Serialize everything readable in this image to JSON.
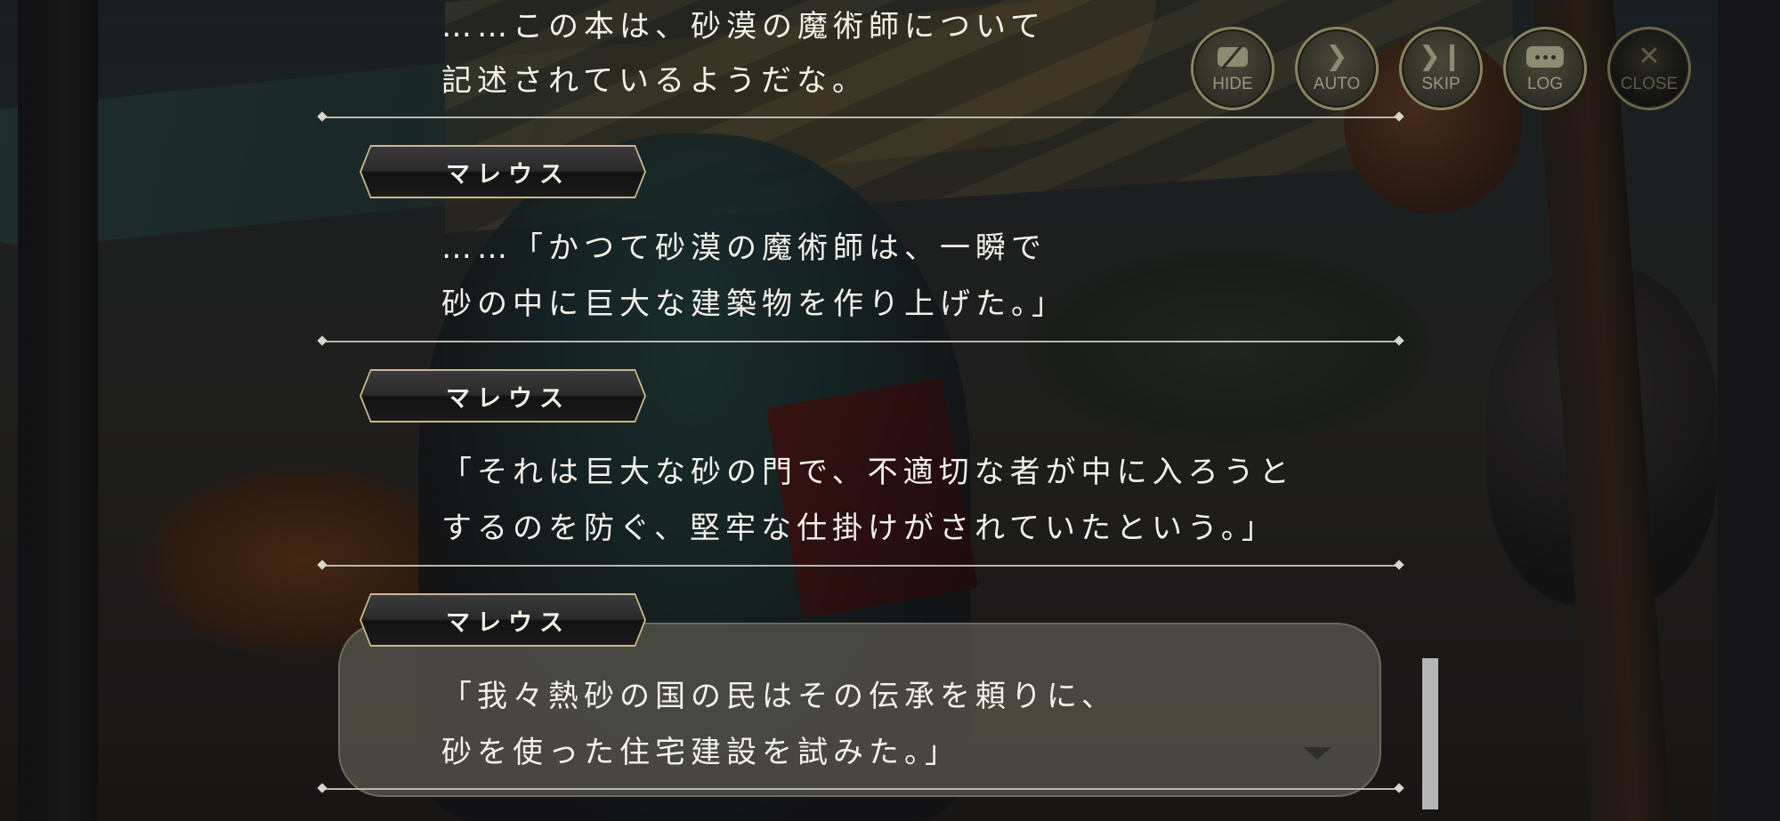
{
  "controls": {
    "hide": "HIDE",
    "auto": "AUTO",
    "skip": "SKIP",
    "log": "LOG",
    "close": "CLOSE"
  },
  "log_entries": [
    {
      "speaker": "",
      "lines": [
        "……この本は、砂漠の魔術師について",
        "記述されているようだな。"
      ]
    },
    {
      "speaker": "マレウス",
      "lines": [
        "……「かつて砂漠の魔術師は、一瞬で",
        "砂の中に巨大な建築物を作り上げた。」"
      ]
    },
    {
      "speaker": "マレウス",
      "lines": [
        "「それは巨大な砂の門で、不適切な者が中に入ろうと",
        "するのを防ぐ、堅牢な仕掛けがされていたという。」"
      ]
    },
    {
      "speaker": "マレウス",
      "lines": [
        "「我々熱砂の国の民はその伝承を頼りに、",
        "砂を使った住宅建設を試みた。」"
      ]
    }
  ],
  "icons": {
    "hide": "hide-icon",
    "auto": "play-icon",
    "skip": "skip-icon",
    "log": "speech-bubble-icon",
    "close": "close-icon",
    "next": "chevron-down-icon"
  }
}
